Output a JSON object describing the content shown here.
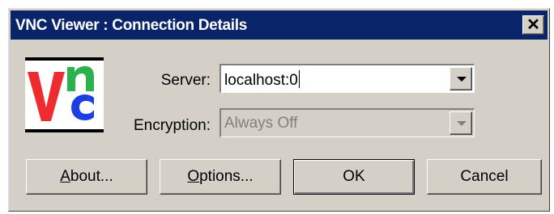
{
  "window": {
    "title": "VNC Viewer : Connection Details",
    "close_glyph": "✕",
    "logo": {
      "text": "VNC",
      "letter_v": "V",
      "letter_n": "n",
      "letter_c": "c",
      "colors": {
        "v": "#ee2b2e",
        "n": "#2bb24c",
        "c": "#1b3fe0"
      }
    }
  },
  "form": {
    "server_label": "Server:",
    "server_value": "localhost:0",
    "encryption_label": "Encryption:",
    "encryption_value": "Always Off"
  },
  "buttons": {
    "about": {
      "mnemonic": "A",
      "rest": "bout..."
    },
    "options": {
      "mnemonic": "O",
      "rest": "ptions..."
    },
    "ok": "OK",
    "cancel": "Cancel"
  },
  "colors": {
    "titlebar": "#0a246a",
    "face": "#d4d0c8"
  }
}
